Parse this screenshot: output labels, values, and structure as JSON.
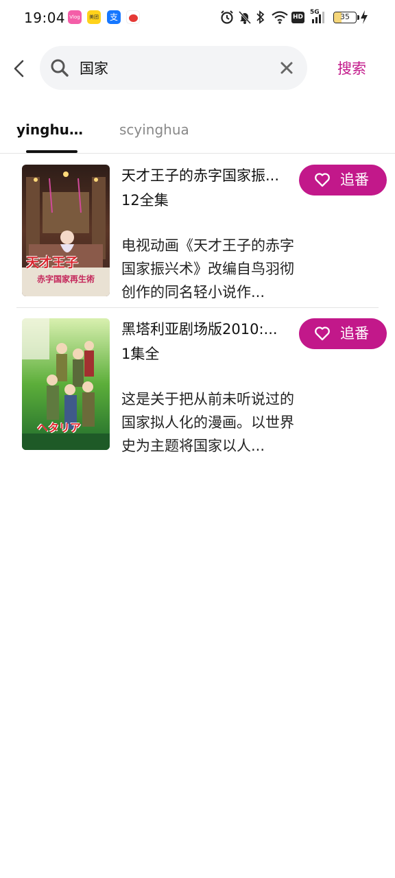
{
  "status_bar": {
    "time": "19:04",
    "apps": [
      {
        "icon": "pink-app-icon",
        "label": "Vlog"
      },
      {
        "icon": "meituan-icon",
        "label": "美团"
      },
      {
        "icon": "alipay-icon",
        "label": "支"
      },
      {
        "icon": "red-app-icon",
        "label": ""
      }
    ],
    "icons": [
      "alarm-icon",
      "mute-icon",
      "bluetooth-icon",
      "wifi-icon",
      "hd-icon",
      "signal-5g-icon"
    ],
    "hd_label": "HD",
    "network_label": "5G",
    "battery": {
      "level_percent": 35,
      "label": "35",
      "charging": true
    }
  },
  "header": {
    "search_value": "国家",
    "search_placeholder": "",
    "search_button_label": "搜索"
  },
  "tabs": [
    {
      "label": "yinghua...",
      "active": true
    },
    {
      "label": "scyinghua",
      "active": false
    }
  ],
  "results": [
    {
      "title": "天才王子的赤字国家振...",
      "episodes": "12全集",
      "description": "电视动画《天才王子的赤字国家振兴术》改编自鸟羽彻创作的同名轻小说作...",
      "follow_label": "追番",
      "poster_text": "天才王子",
      "poster_subtext": "赤字国家再生術"
    },
    {
      "title": "黑塔利亚剧场版2010:...",
      "episodes": "1集全",
      "description": "这是关于把从前未听说过的国家拟人化的漫画。以世界史为主题将国家以人...",
      "follow_label": "追番",
      "poster_text": "ヘタリア",
      "poster_subtext": ""
    }
  ],
  "colors": {
    "accent": "#c2188a",
    "tab_inactive": "#888888",
    "divider": "#e4e4e4",
    "search_bg": "#f3f4f6"
  }
}
